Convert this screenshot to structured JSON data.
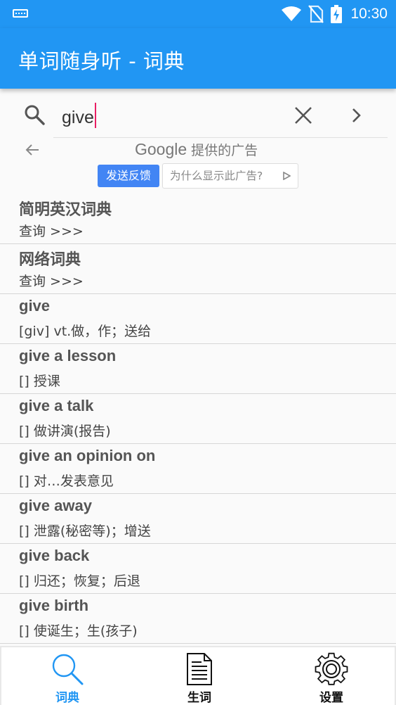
{
  "status_bar": {
    "time": "10:30"
  },
  "app_bar": {
    "title": "单词随身听 - 词典"
  },
  "search": {
    "query": "give"
  },
  "ad": {
    "brand": "Google",
    "brand_suffix": "提供的广告",
    "feedback_label": "发送反馈",
    "why_label": "为什么显示此广告?"
  },
  "results": [
    {
      "word": "简明英汉词典",
      "definition": "查询 >>>"
    },
    {
      "word": "网络词典",
      "definition": "查询 >>>"
    },
    {
      "word": "give",
      "definition": "[giv] vt.做，作；送给"
    },
    {
      "word": "give a lesson",
      "definition": "[] 授课"
    },
    {
      "word": "give a talk",
      "definition": "[] 做讲演(报告)"
    },
    {
      "word": "give an opinion on",
      "definition": "[] 对…发表意见"
    },
    {
      "word": "give away",
      "definition": "[] 泄露(秘密等)；增送"
    },
    {
      "word": "give back",
      "definition": "[] 归还；恢复；后退"
    },
    {
      "word": "give birth",
      "definition": "[] 使诞生；生(孩子)"
    }
  ],
  "bottom_nav": [
    {
      "label": "词典",
      "icon": "magnifier-icon",
      "active": true
    },
    {
      "label": "生词",
      "icon": "document-icon",
      "active": false
    },
    {
      "label": "设置",
      "icon": "gear-icon",
      "active": false
    }
  ],
  "colors": {
    "primary": "#2196f3",
    "caret": "#e91e63",
    "ad_button": "#4285f4"
  }
}
